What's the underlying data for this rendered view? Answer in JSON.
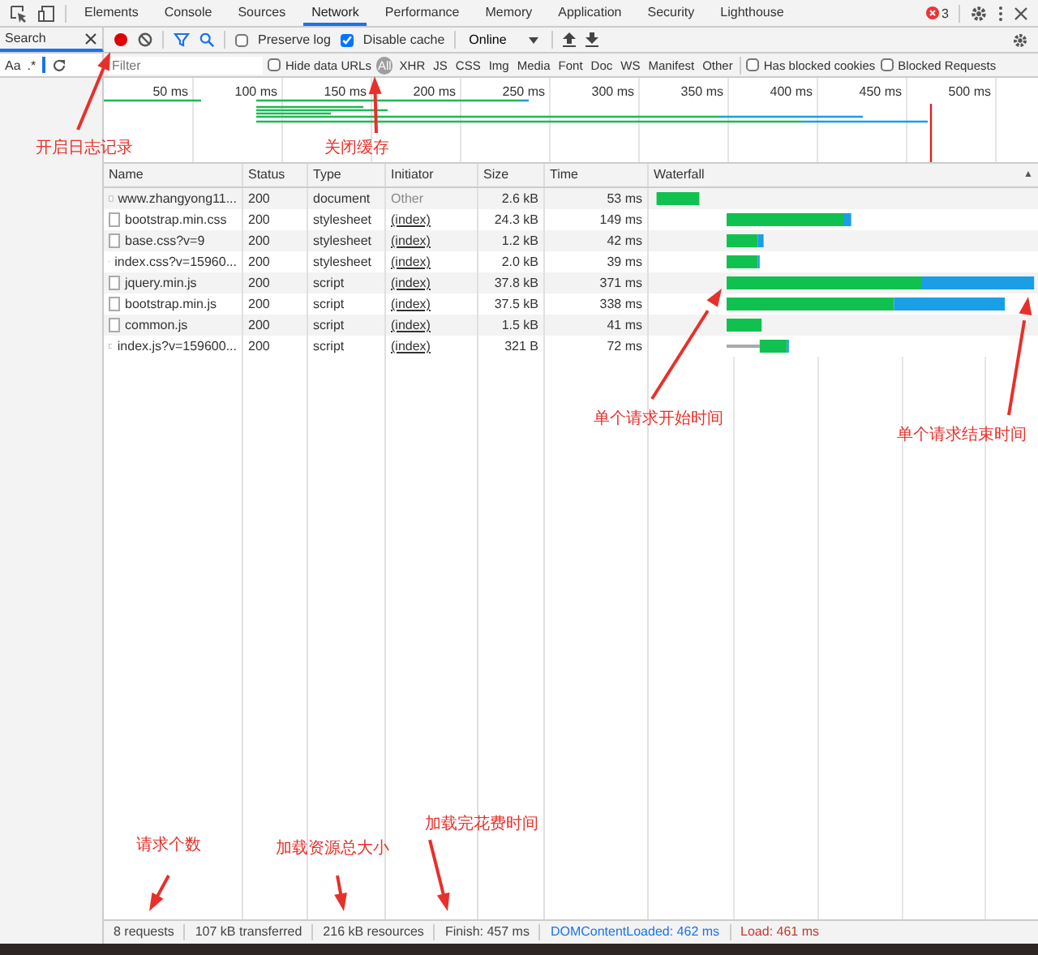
{
  "tabs": [
    {
      "label": "Elements",
      "selected": false
    },
    {
      "label": "Console",
      "selected": false
    },
    {
      "label": "Sources",
      "selected": false
    },
    {
      "label": "Network",
      "selected": true
    },
    {
      "label": "Performance",
      "selected": false
    },
    {
      "label": "Memory",
      "selected": false
    },
    {
      "label": "Application",
      "selected": false
    },
    {
      "label": "Security",
      "selected": false
    },
    {
      "label": "Lighthouse",
      "selected": false
    }
  ],
  "error_count": "3",
  "search_panel": {
    "title": "Search",
    "case_button": "Aa",
    "regex_button": ".*"
  },
  "toolbar": {
    "recording": true,
    "preserve_log": {
      "label": "Preserve log",
      "checked": false
    },
    "disable_cache": {
      "label": "Disable cache",
      "checked": true
    },
    "throttling": "Online"
  },
  "filter": {
    "placeholder": "Filter",
    "hide_data_urls": {
      "label": "Hide data URLs",
      "checked": false
    },
    "types": [
      {
        "label": "All",
        "selected": true
      },
      {
        "label": "XHR",
        "selected": false
      },
      {
        "label": "JS",
        "selected": false
      },
      {
        "label": "CSS",
        "selected": false
      },
      {
        "label": "Img",
        "selected": false
      },
      {
        "label": "Media",
        "selected": false
      },
      {
        "label": "Font",
        "selected": false
      },
      {
        "label": "Doc",
        "selected": false
      },
      {
        "label": "WS",
        "selected": false
      },
      {
        "label": "Manifest",
        "selected": false
      },
      {
        "label": "Other",
        "selected": false
      }
    ],
    "blocked_cookies": {
      "label": "Has blocked cookies",
      "checked": false
    },
    "blocked_requests": {
      "label": "Blocked Requests",
      "checked": false
    }
  },
  "overview": {
    "ticks": [
      "50 ms",
      "100 ms",
      "150 ms",
      "200 ms",
      "250 ms",
      "300 ms",
      "350 ms",
      "400 ms",
      "450 ms",
      "500 ms"
    ]
  },
  "table": {
    "columns": [
      "Name",
      "Status",
      "Type",
      "Initiator",
      "Size",
      "Time",
      "Waterfall"
    ],
    "sort_indicator": "▲",
    "rows": [
      {
        "name": "www.zhangyong11...",
        "status": "200",
        "type": "document",
        "initiator": "Other",
        "link": false,
        "size": "2.6 kB",
        "time": "53 ms"
      },
      {
        "name": "bootstrap.min.css",
        "status": "200",
        "type": "stylesheet",
        "initiator": "(index)",
        "link": true,
        "size": "24.3 kB",
        "time": "149 ms"
      },
      {
        "name": "base.css?v=9",
        "status": "200",
        "type": "stylesheet",
        "initiator": "(index)",
        "link": true,
        "size": "1.2 kB",
        "time": "42 ms"
      },
      {
        "name": "index.css?v=15960...",
        "status": "200",
        "type": "stylesheet",
        "initiator": "(index)",
        "link": true,
        "size": "2.0 kB",
        "time": "39 ms"
      },
      {
        "name": "jquery.min.js",
        "status": "200",
        "type": "script",
        "initiator": "(index)",
        "link": true,
        "size": "37.8 kB",
        "time": "371 ms"
      },
      {
        "name": "bootstrap.min.js",
        "status": "200",
        "type": "script",
        "initiator": "(index)",
        "link": true,
        "size": "37.5 kB",
        "time": "338 ms"
      },
      {
        "name": "common.js",
        "status": "200",
        "type": "script",
        "initiator": "(index)",
        "link": true,
        "size": "1.5 kB",
        "time": "41 ms"
      },
      {
        "name": "index.js?v=159600...",
        "status": "200",
        "type": "script",
        "initiator": "(index)",
        "link": true,
        "size": "321 B",
        "time": "72 ms"
      }
    ]
  },
  "status_bar": [
    {
      "text": "8 requests",
      "kind": "plain"
    },
    {
      "text": "107 kB transferred",
      "kind": "plain"
    },
    {
      "text": "216 kB resources",
      "kind": "plain"
    },
    {
      "text": "Finish: 457 ms",
      "kind": "plain"
    },
    {
      "text": "DOMContentLoaded: 462 ms",
      "kind": "dom"
    },
    {
      "text": "Load: 461 ms",
      "kind": "load"
    }
  ],
  "annotations": [
    {
      "text": "开启日志记录"
    },
    {
      "text": "关闭缓存"
    },
    {
      "text": "单个请求开始时间"
    },
    {
      "text": "单个请求结束时间"
    },
    {
      "text": "请求个数"
    },
    {
      "text": "加载资源总大小"
    },
    {
      "text": "加载完花费时间"
    }
  ]
}
